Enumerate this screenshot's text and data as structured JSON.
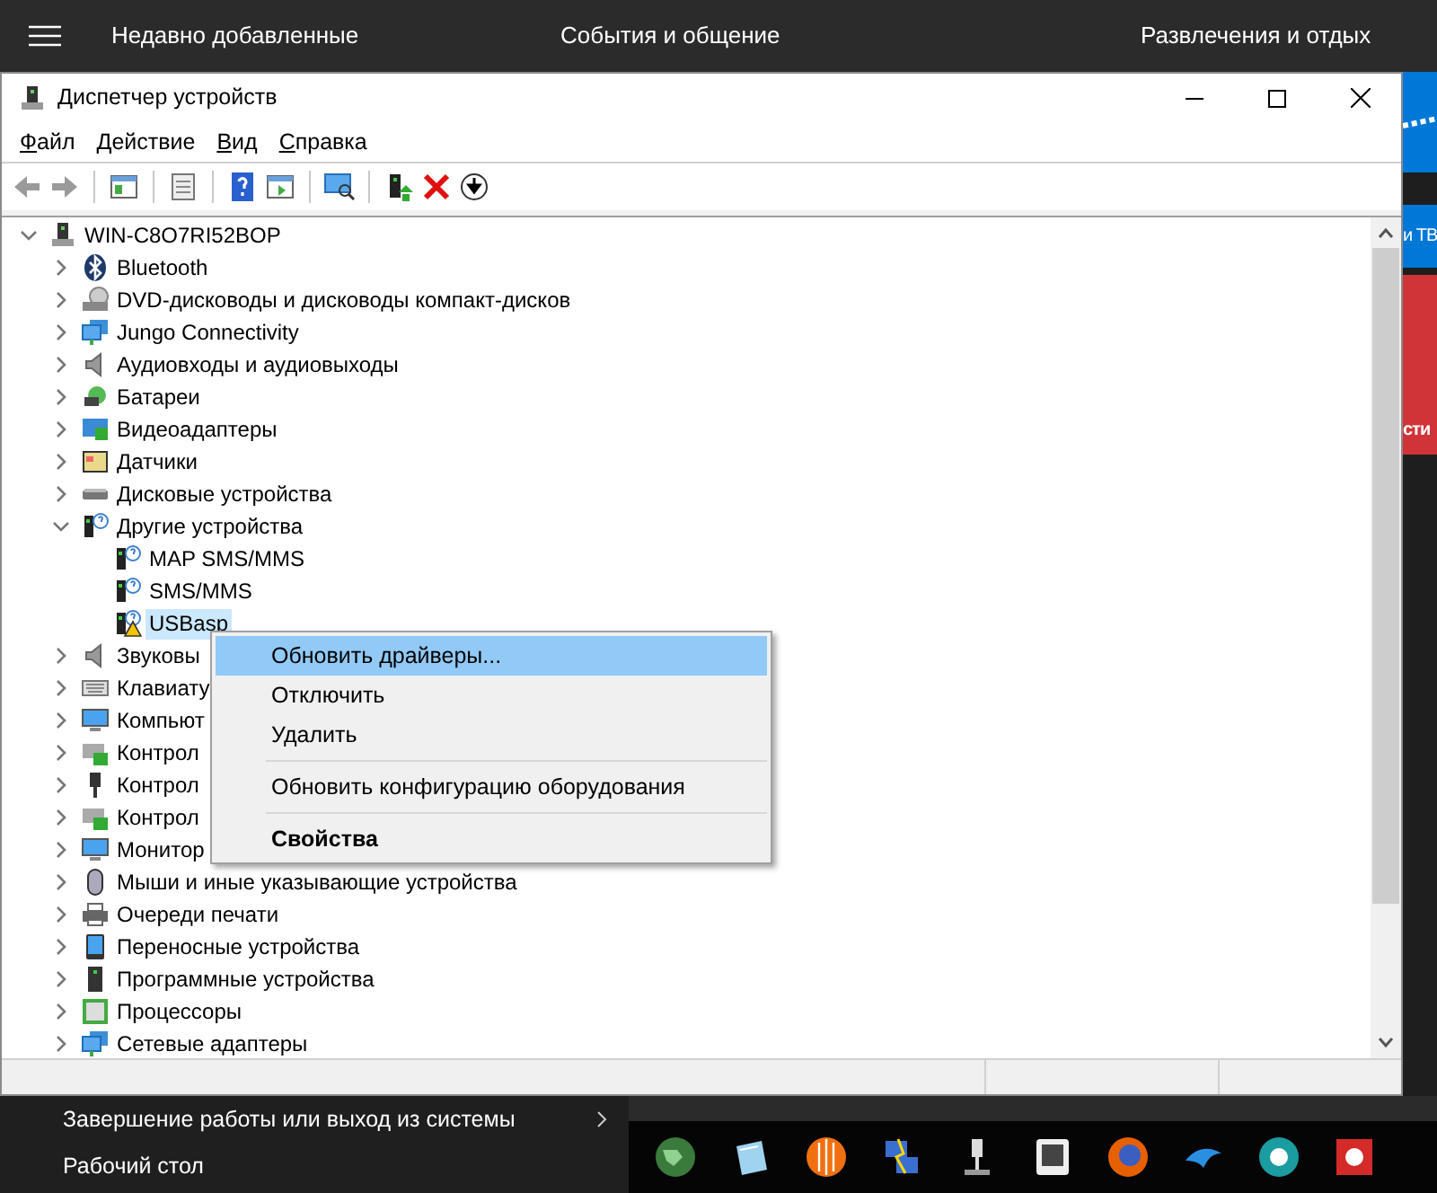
{
  "top_bar": {
    "headers": [
      "Недавно добавленные",
      "События и общение",
      "Развлечения и отдых"
    ]
  },
  "window": {
    "title": "Диспетчер устройств"
  },
  "menu_bar": [
    {
      "label": "Файл"
    },
    {
      "label": "Действие"
    },
    {
      "label": "Вид"
    },
    {
      "label": "Справка"
    }
  ],
  "tree": [
    {
      "label": "WIN-C8O7RI52BOP",
      "kind": "computer",
      "expanded": true,
      "selected": false,
      "children": [
        {
          "label": "Bluetooth",
          "kind": "bluetooth",
          "expanded": false,
          "selected": false
        },
        {
          "label": "DVD-дисководы и дисководы компакт-дисков",
          "kind": "dvd",
          "expanded": false,
          "selected": false
        },
        {
          "label": "Jungo Connectivity",
          "kind": "network",
          "expanded": false,
          "selected": false
        },
        {
          "label": "Аудиовходы и аудиовыходы",
          "kind": "speaker",
          "expanded": false,
          "selected": false
        },
        {
          "label": "Батареи",
          "kind": "battery",
          "expanded": false,
          "selected": false
        },
        {
          "label": "Видеоадаптеры",
          "kind": "display",
          "expanded": false,
          "selected": false
        },
        {
          "label": "Датчики",
          "kind": "sensor",
          "expanded": false,
          "selected": false
        },
        {
          "label": "Дисковые устройства",
          "kind": "disk",
          "expanded": false,
          "selected": false
        },
        {
          "label": "Другие устройства",
          "kind": "unknown",
          "expanded": true,
          "selected": false,
          "children": [
            {
              "label": "MAP SMS/MMS",
              "kind": "unknown",
              "warning": false,
              "selected": false
            },
            {
              "label": "SMS/MMS",
              "kind": "unknown",
              "warning": false,
              "selected": false
            },
            {
              "label": "USBasp",
              "kind": "unknown",
              "warning": true,
              "selected": true
            }
          ]
        },
        {
          "label": "Звуковы",
          "kind": "speaker",
          "expanded": false,
          "selected": false
        },
        {
          "label": "Клавиату",
          "kind": "keyboard",
          "expanded": false,
          "selected": false
        },
        {
          "label": "Компьют",
          "kind": "monitor",
          "expanded": false,
          "selected": false
        },
        {
          "label": "Контрол",
          "kind": "controller",
          "expanded": false,
          "selected": false
        },
        {
          "label": "Контрол",
          "kind": "usb",
          "expanded": false,
          "selected": false
        },
        {
          "label": "Контрол",
          "kind": "controller",
          "expanded": false,
          "selected": false
        },
        {
          "label": "Монитор",
          "kind": "monitor",
          "expanded": false,
          "selected": false
        },
        {
          "label": "Мыши и иные указывающие устройства",
          "kind": "mouse",
          "expanded": false,
          "selected": false
        },
        {
          "label": "Очереди печати",
          "kind": "printer",
          "expanded": false,
          "selected": false
        },
        {
          "label": "Переносные устройства",
          "kind": "portable",
          "expanded": false,
          "selected": false
        },
        {
          "label": "Программные устройства",
          "kind": "software",
          "expanded": false,
          "selected": false
        },
        {
          "label": "Процессоры",
          "kind": "processor",
          "expanded": false,
          "selected": false
        },
        {
          "label": "Сетевые адаптеры",
          "kind": "network",
          "expanded": false,
          "selected": false
        }
      ]
    }
  ],
  "context_menu": [
    {
      "kind": "item",
      "label": "Обновить драйверы...",
      "selected": true,
      "default": false
    },
    {
      "kind": "item",
      "label": "Отключить",
      "selected": false,
      "default": false
    },
    {
      "kind": "item",
      "label": "Удалить",
      "selected": false,
      "default": false
    },
    {
      "kind": "separator"
    },
    {
      "kind": "item",
      "label": "Обновить конфигурацию оборудования",
      "selected": false,
      "default": false
    },
    {
      "kind": "separator"
    },
    {
      "kind": "item",
      "label": "Свойства",
      "selected": false,
      "default": true
    }
  ],
  "side_tiles": [
    {
      "label": "и ТВ",
      "color": "#0078d7"
    },
    {
      "label": "сти",
      "color": "#d13438"
    }
  ],
  "start_menu": [
    {
      "label": "Завершение работы или выход из системы",
      "submenu": true
    },
    {
      "label": "Рабочий стол",
      "submenu": false
    }
  ]
}
